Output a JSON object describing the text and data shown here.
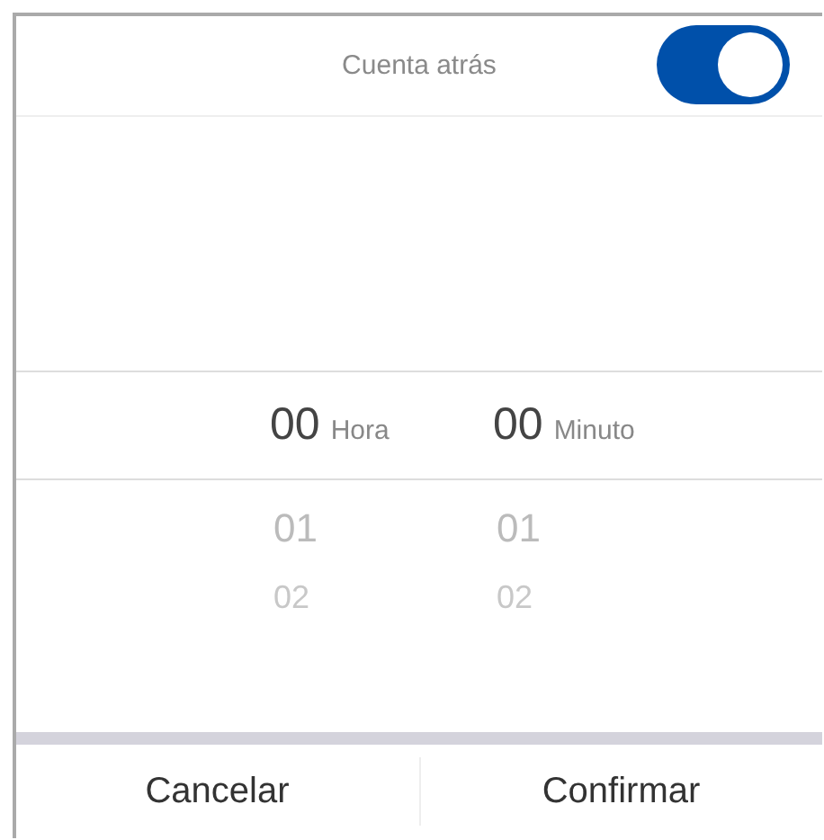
{
  "header": {
    "title": "Cuenta atrás",
    "toggle": {
      "on": true
    }
  },
  "picker": {
    "columns": [
      {
        "value": "00",
        "unit": "Hora",
        "options": [
          "01",
          "02"
        ]
      },
      {
        "value": "00",
        "unit": "Minuto",
        "options": [
          "01",
          "02"
        ]
      }
    ]
  },
  "buttons": [
    {
      "label": "Cancelar"
    },
    {
      "label": "Confirmar"
    }
  ]
}
